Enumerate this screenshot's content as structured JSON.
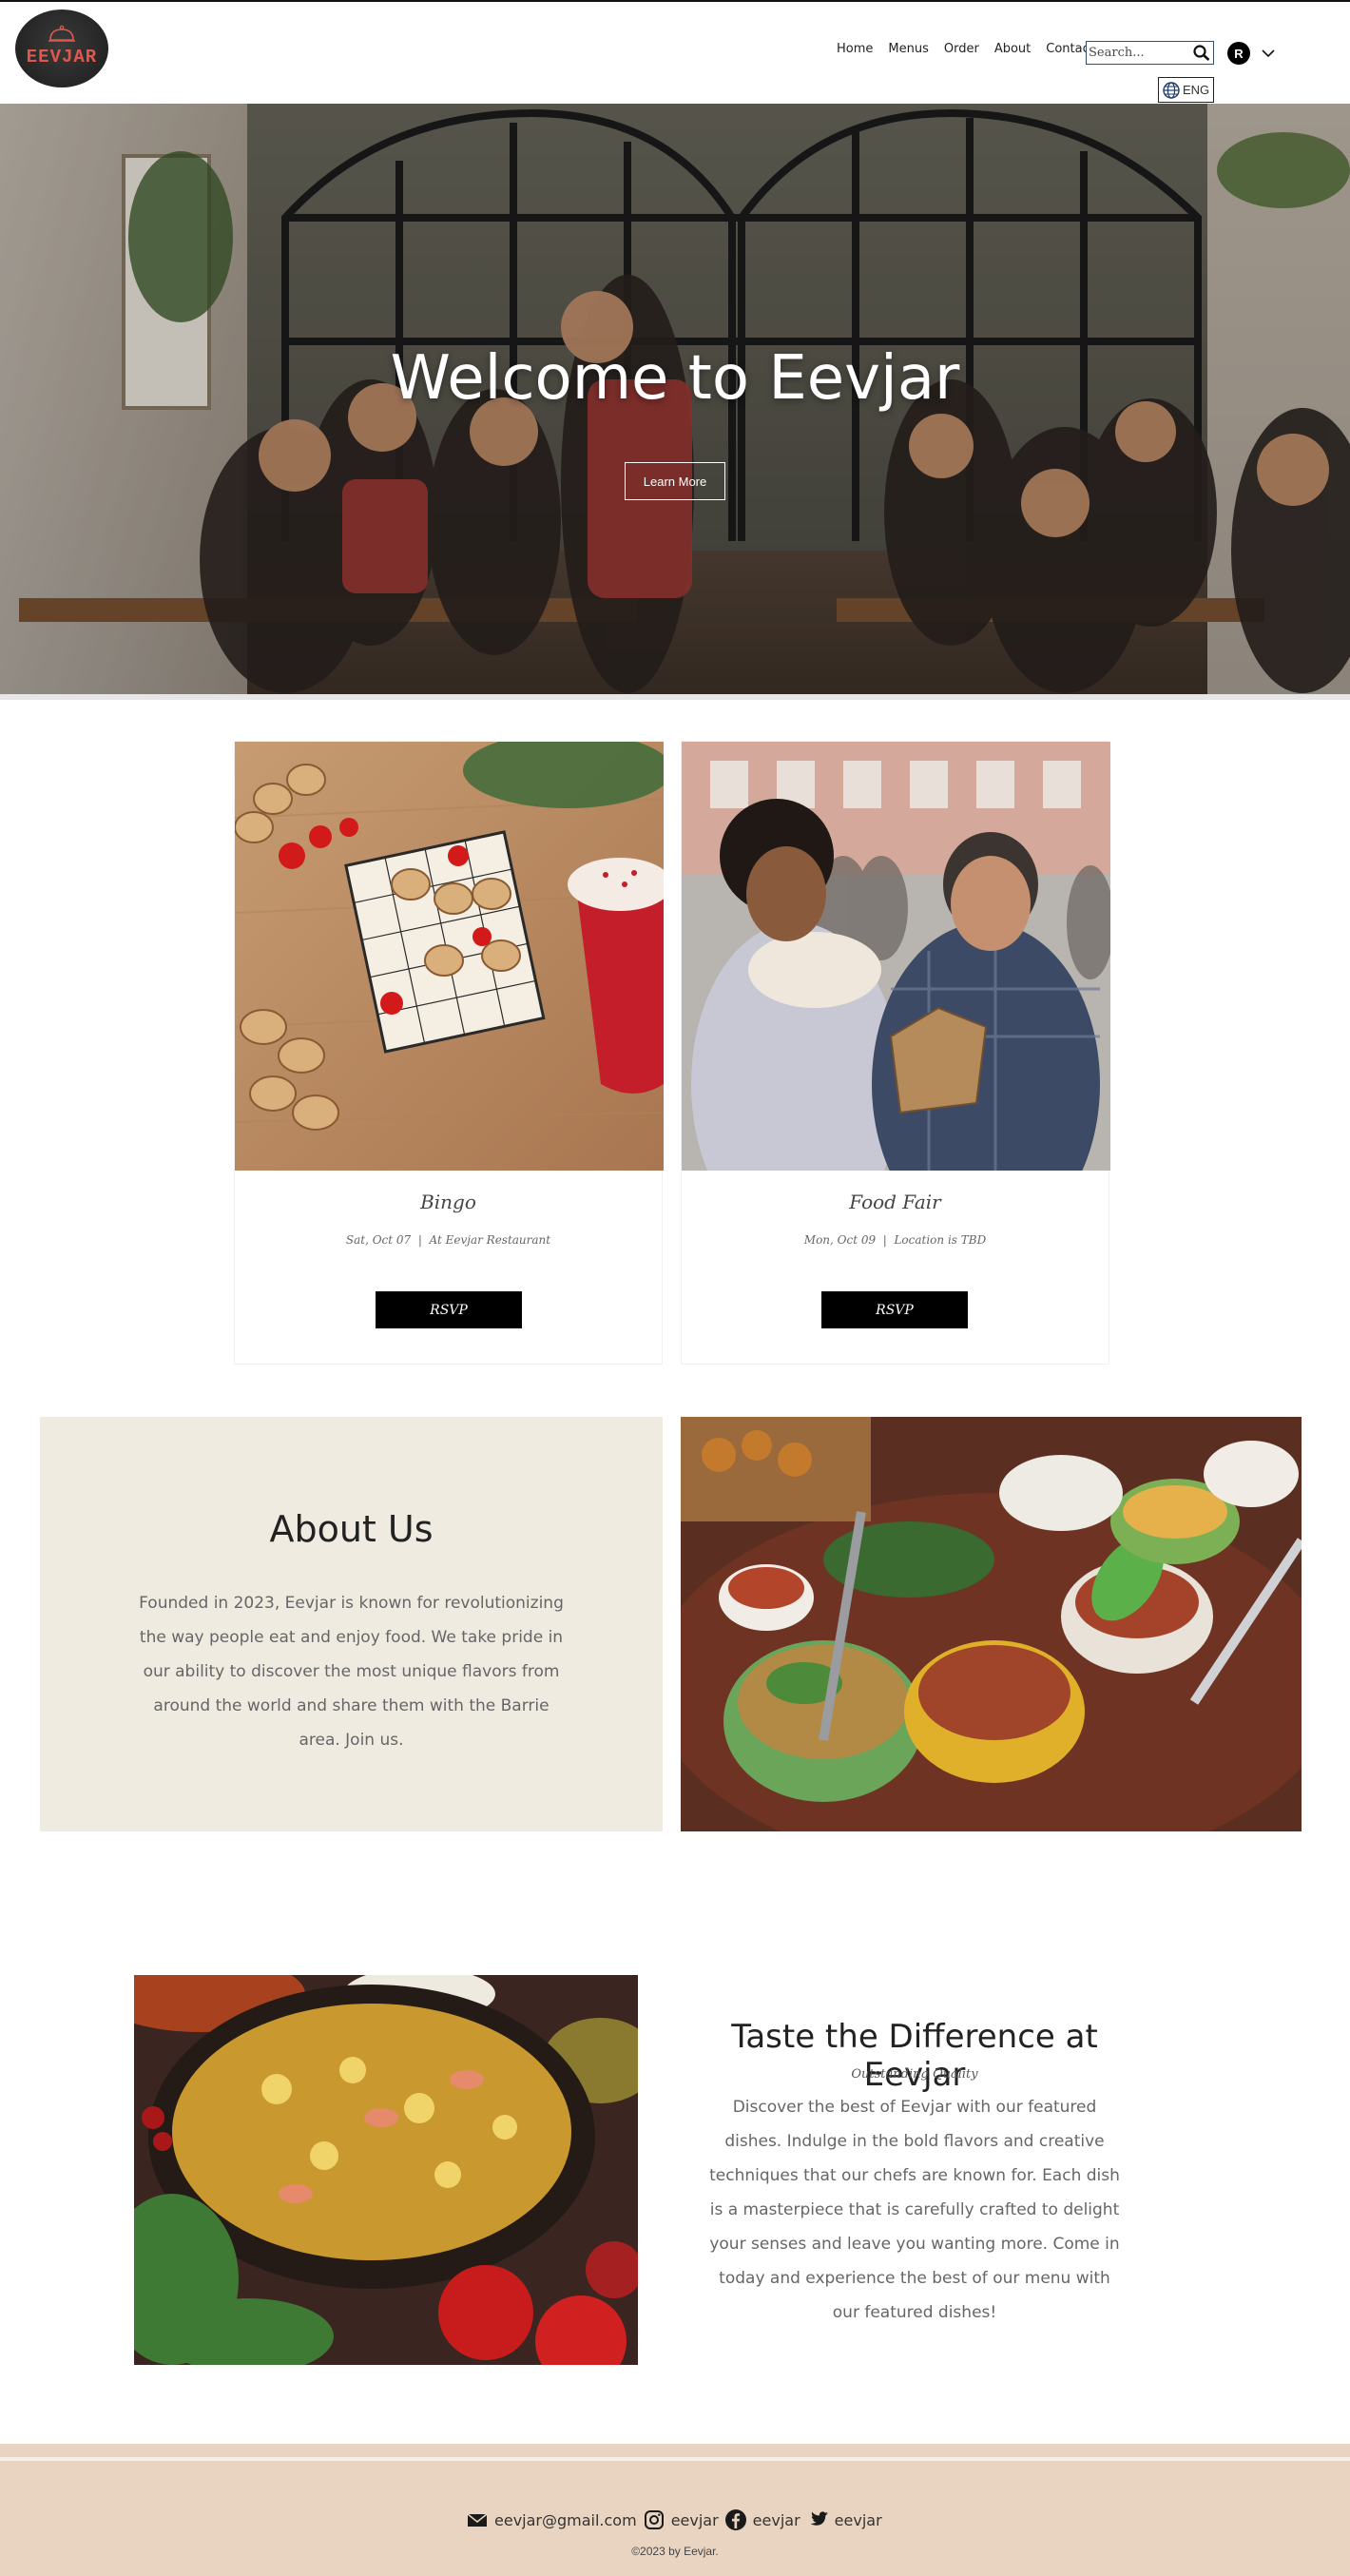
{
  "header": {
    "logo_text": "EEVJAR",
    "nav": [
      "Home",
      "Menus",
      "Order",
      "About",
      "Contact"
    ],
    "search_placeholder": "Search...",
    "avatar_initial": "R",
    "language": "ENG"
  },
  "hero": {
    "title": "Welcome to Eevjar",
    "button": "Learn More"
  },
  "events": [
    {
      "title": "Bingo",
      "date": "Sat, Oct 07",
      "location": "At Eevjar Restaurant",
      "separator": "|",
      "button": "RSVP"
    },
    {
      "title": "Food Fair",
      "date": "Mon, Oct 09",
      "location": "Location is TBD",
      "separator": "|",
      "button": "RSVP"
    }
  ],
  "about": {
    "title": "About Us",
    "text": "Founded in 2023, Eevjar is known for revolutionizing the way people eat and enjoy food. We take pride in our ability to discover the most unique flavors from around the world and share them with the Barrie area. Join us."
  },
  "taste": {
    "title": "Taste the Difference at Eevjar",
    "subtitle": "Outstanding Quality",
    "text": "Discover the best of Eevjar with our featured dishes. Indulge in the bold flavors and creative techniques that our chefs are known for. Each dish is a masterpiece that is carefully crafted to delight your senses and leave you wanting more. Come in today and experience the best of our menu with our featured dishes!"
  },
  "footer": {
    "email": "eevjar@gmail.com",
    "instagram": "eevjar",
    "facebook": "eevjar",
    "twitter": "eevjar",
    "copyright": "©2023 by Eevjar."
  },
  "colors": {
    "accent_logo": "#e0574f",
    "about_bg": "#efebe0",
    "footer_bg": "#e8d4c0",
    "button_bg": "#000000"
  }
}
